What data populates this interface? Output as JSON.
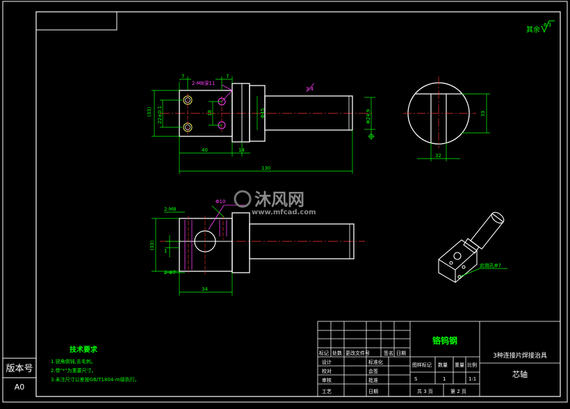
{
  "drawing": {
    "roughness_note": "其余",
    "roughness_value": "6.3",
    "tech_title": "技术要求",
    "tech_lines": [
      "1.锐角倒钝,去毛刺。",
      "2.带\"*\"为重要尺寸。",
      "3.未注尺寸公差按GB/T1804-m级执行。"
    ],
    "version_label": "版本号",
    "version_value": "A0",
    "watermark_cn": "沐风网",
    "watermark_url": "www.mfcad.com",
    "dims": {
      "d7a": "7",
      "d7b": "7",
      "hole_note": "2-M8深11",
      "d33": "(33)",
      "d22": "22±0.1",
      "d18": "18",
      "d45": "Φ45",
      "d40": "40",
      "d14": "14",
      "d130": "130",
      "d249": "Φ24.9",
      "d32": "32",
      "d33b": "33",
      "d34": "3.4",
      "m8": "2-M8",
      "d10": "Φ10",
      "d33c": "(33)",
      "d1": "1",
      "phi7": "2-Φ7",
      "d34b": "34",
      "iso_note": "此销孔Φ7"
    },
    "titleblock": {
      "material": "铬钨钢",
      "project": "3种连接片焊接治具",
      "part": "芯轴",
      "rev_headers": [
        "标记",
        "处数",
        "更改文件号",
        "签名",
        "日期"
      ],
      "roles": [
        "设计",
        "校对",
        "审核",
        "工艺"
      ],
      "roles2": [
        "标准化",
        "会签",
        "批准",
        "日期"
      ],
      "mid_headers": [
        "图样标记",
        "数量",
        "重量",
        "比例"
      ],
      "mark": "S",
      "qty": "1",
      "scale": "1:1",
      "total_pages": "共 3 页",
      "page_no": "第 2 页"
    }
  },
  "colors": {
    "outline": "#ffffff",
    "dimension": "#00ff00",
    "centerline": "#ff3333",
    "hidden": "#ff40ff",
    "leader": "#ff40ff",
    "annotation": "#00ff00"
  }
}
